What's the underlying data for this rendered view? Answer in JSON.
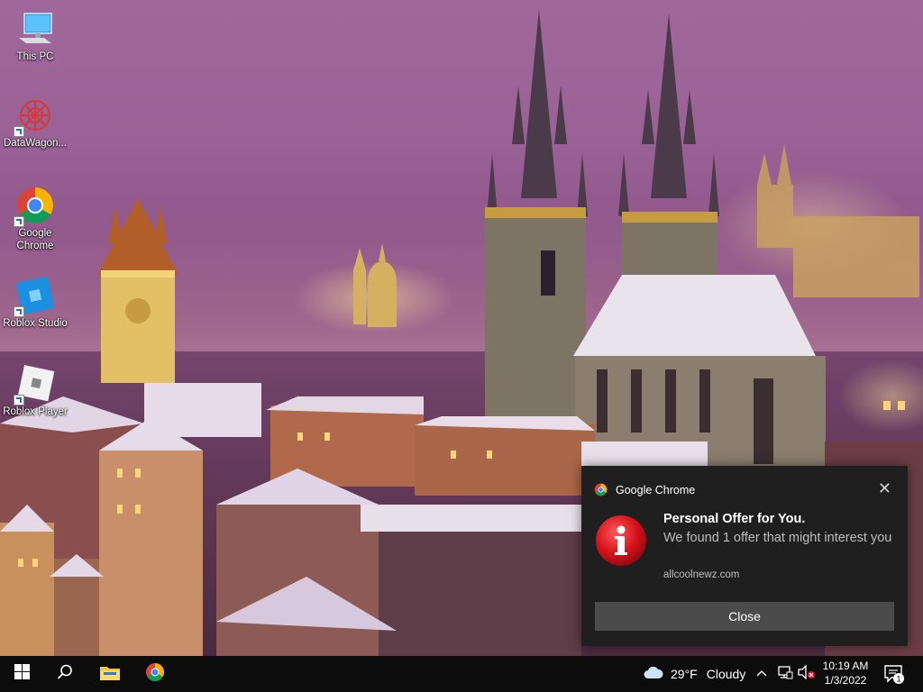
{
  "desktop": {
    "icons": [
      {
        "label": "This PC",
        "icon": "computer-icon"
      },
      {
        "label": "DataWagon...",
        "icon": "datawagon-icon"
      },
      {
        "label": "Google Chrome",
        "icon": "chrome-icon"
      },
      {
        "label": "Roblox Studio",
        "icon": "roblox-studio-icon"
      },
      {
        "label": "Roblox Player",
        "icon": "roblox-player-icon"
      }
    ]
  },
  "notification": {
    "app_name": "Google Chrome",
    "title": "Personal Offer for You.",
    "body": "We found 1 offer that might interest you",
    "site": "allcoolnewz.com",
    "close_label": "Close",
    "dismiss_glyph": "✕",
    "badge_glyph": "i",
    "badge_color": "#d4111a"
  },
  "taskbar": {
    "weather_temp": "29°F",
    "weather_condition": "Cloudy",
    "time": "10:19 AM",
    "date": "1/3/2022",
    "notification_count": "1",
    "icons": [
      "windows-start-icon",
      "search-icon",
      "file-explorer-icon",
      "chrome-icon",
      "weather-cloud-icon",
      "chevron-up-icon",
      "network-icon",
      "volume-muted-icon",
      "notification-center-icon"
    ]
  },
  "colors": {
    "taskbar_bg": "#0c0c0d",
    "toast_bg": "#1f1f1f",
    "toast_button": "#4b4b4b",
    "wallpaper_sky": "#9a6196"
  }
}
